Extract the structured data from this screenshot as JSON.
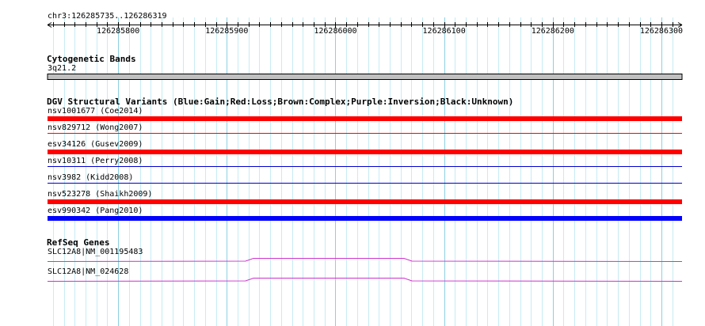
{
  "position_label": "chr3:126285735..126286319",
  "ruler": {
    "start": 126285735,
    "end": 126286319,
    "tick_labels": [
      "126285800",
      "126285900",
      "126286000",
      "126286100",
      "126286200",
      "126286300"
    ],
    "major_ticks": [
      126285800,
      126285900,
      126286000,
      126286100,
      126286200,
      126286300
    ]
  },
  "tracks": {
    "cytoband": {
      "title": "Cytogenetic Bands",
      "band_name": "3q21.2",
      "color": "#c0c0c0"
    },
    "dgv": {
      "title": "DGV Structural Variants (Blue:Gain;Red:Loss;Brown:Complex;Purple:Inversion;Black:Unknown)",
      "features": [
        {
          "label": "nsv1001677 (Coe2014)",
          "type": "loss",
          "color": "#ff0000",
          "weight": "thick"
        },
        {
          "label": "nsv829712 (Wong2007)",
          "type": "loss",
          "color": "#ff0000",
          "weight": "thin"
        },
        {
          "label": "esv34126 (Gusev2009)",
          "type": "loss",
          "color": "#ff0000",
          "weight": "thick"
        },
        {
          "label": "nsv10311 (Perry2008)",
          "type": "gain",
          "color": "#0000cc",
          "weight": "thin"
        },
        {
          "label": "nsv3982 (Kidd2008)",
          "type": "gain",
          "color": "#0000cc",
          "weight": "thin"
        },
        {
          "label": "nsv523278 (Shaikh2009)",
          "type": "loss",
          "color": "#ff0000",
          "weight": "thick"
        },
        {
          "label": "esv990342 (Pang2010)",
          "type": "gain",
          "color": "#0000ff",
          "weight": "thick"
        }
      ]
    },
    "refseq": {
      "title": "RefSeq Genes",
      "color": "#cc33cc",
      "genes": [
        {
          "label": "SLC12A8|NM_001195483"
        },
        {
          "label": "SLC12A8|NM_024628"
        }
      ]
    }
  }
}
